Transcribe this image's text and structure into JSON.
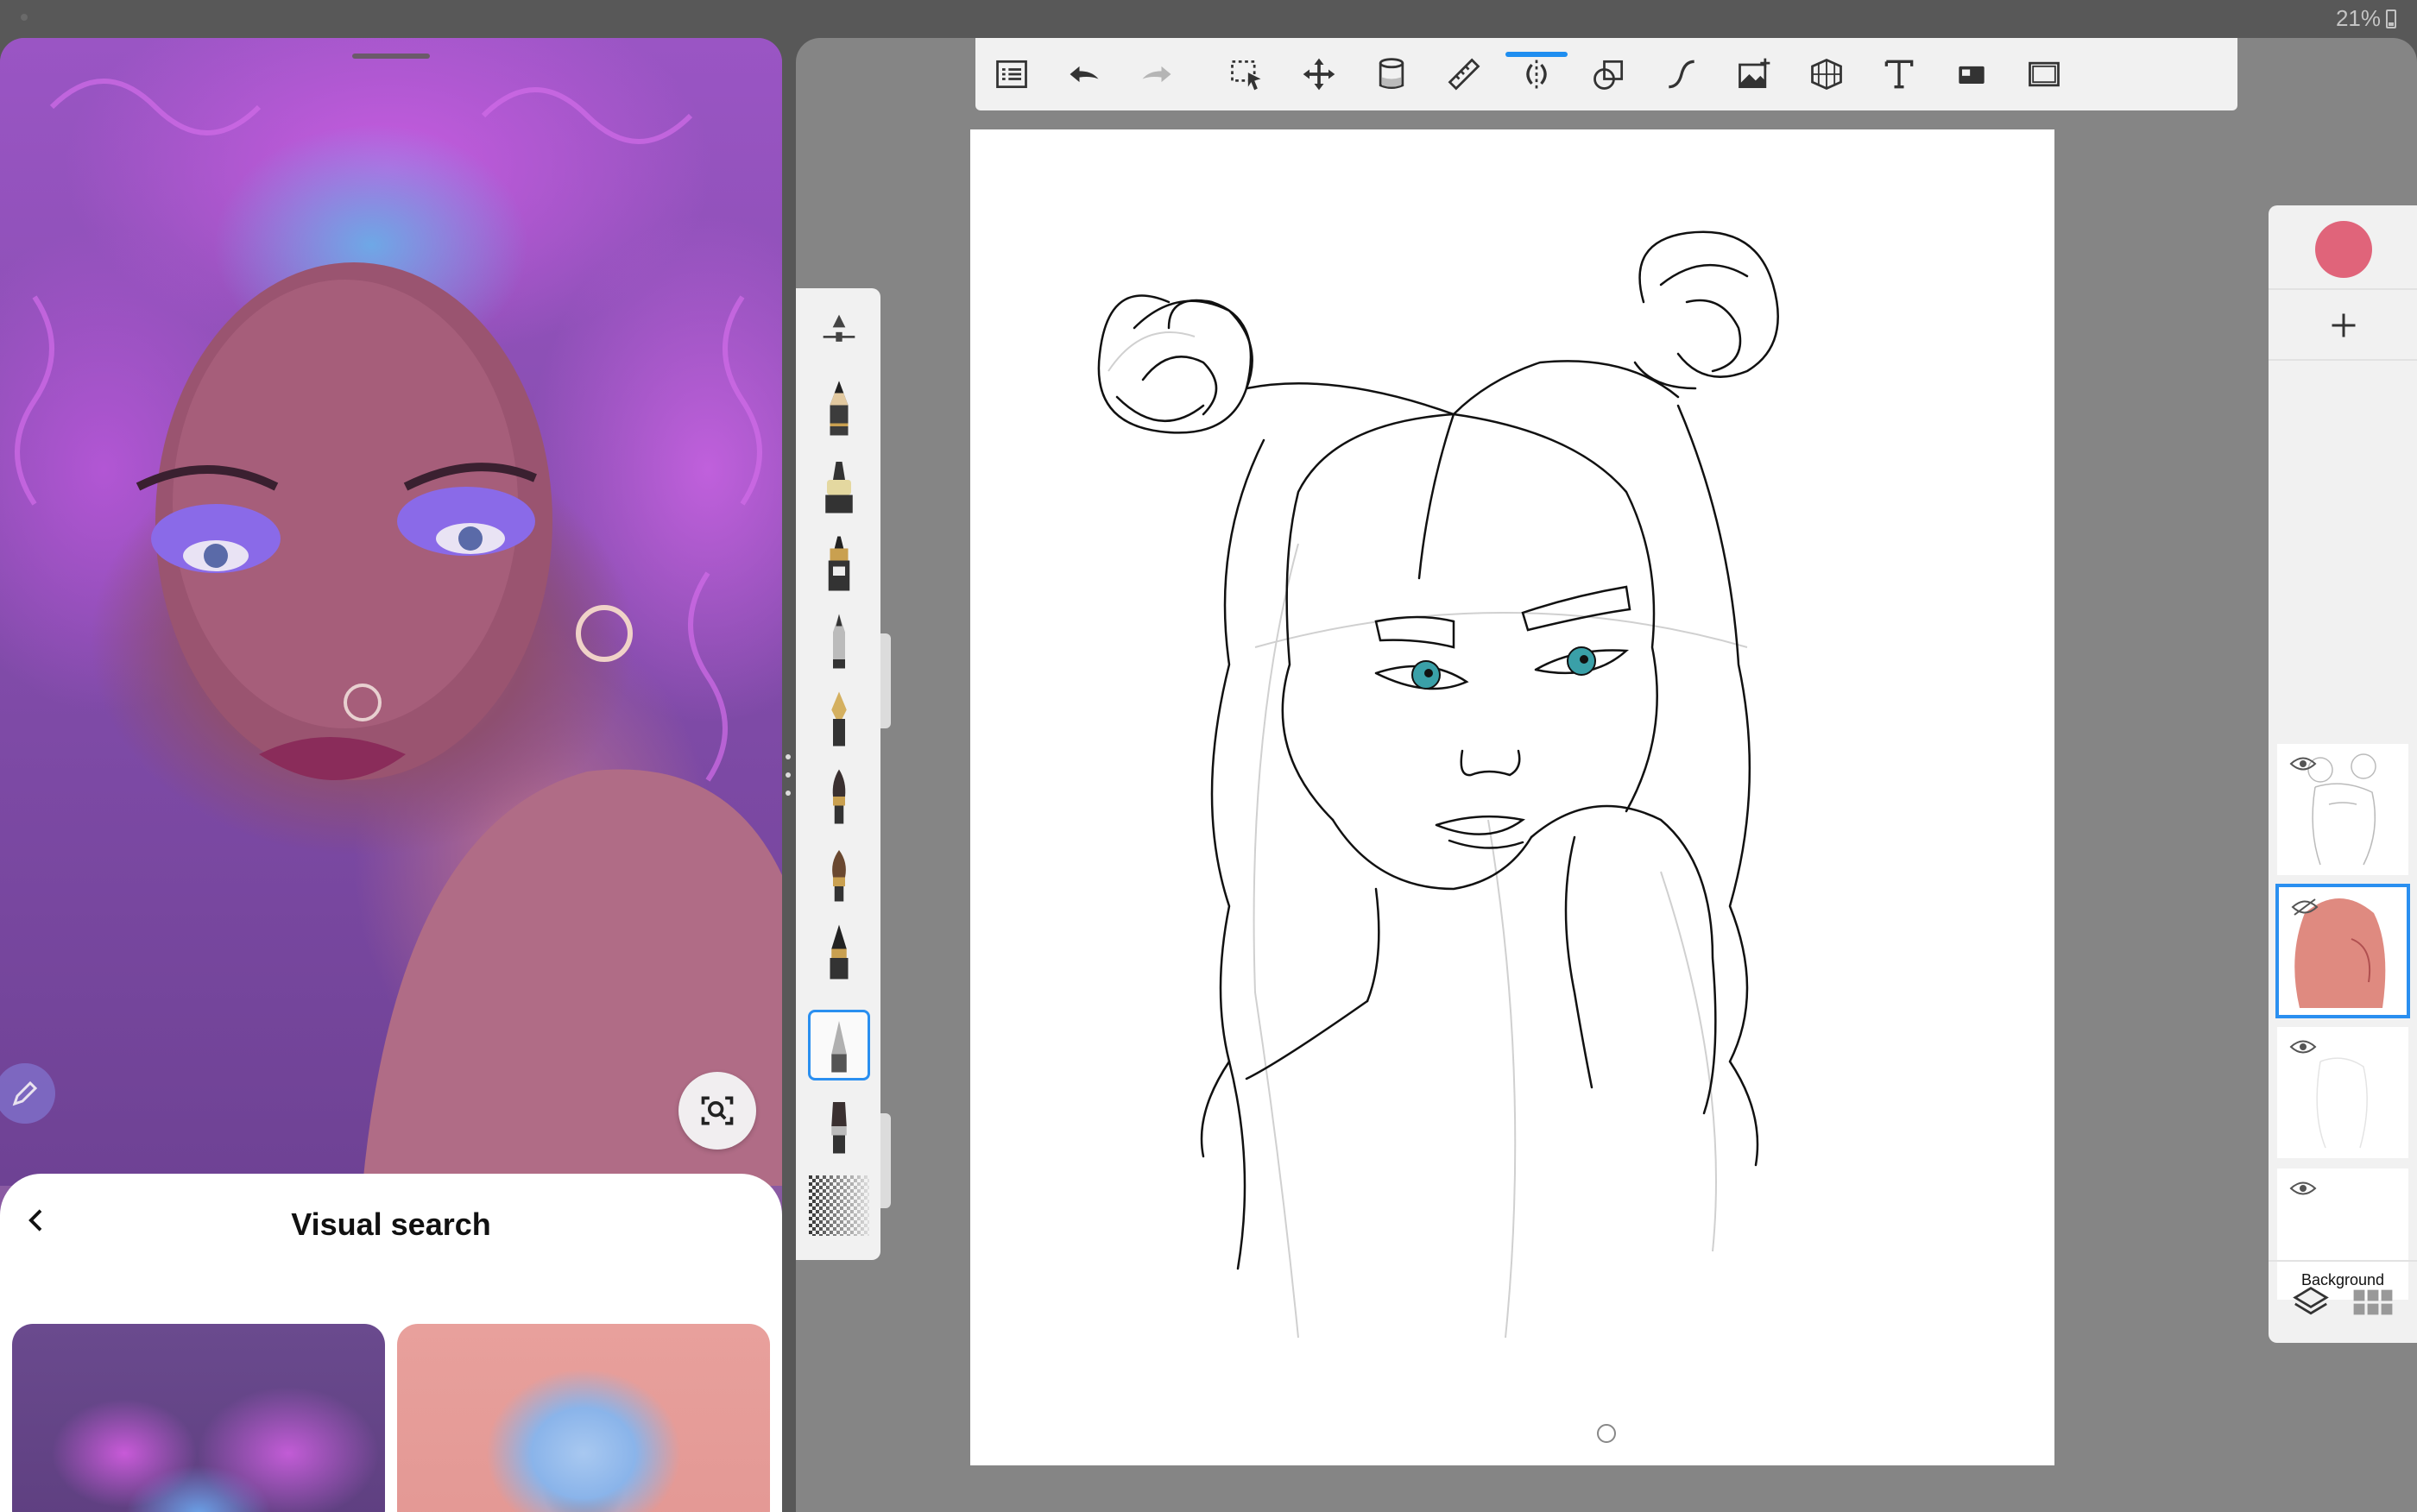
{
  "status_bar": {
    "battery_text": "21%"
  },
  "left_pane": {
    "visual_search": {
      "title": "Visual search",
      "back_icon": "chevron-left-icon",
      "results": [
        {
          "label": "purple-hair-portrait"
        },
        {
          "label": "blue-hair-portrait"
        }
      ]
    },
    "fabs": {
      "edit_icon": "pencil-icon",
      "lens_icon": "visual-search-icon"
    }
  },
  "toolbar": {
    "tools": [
      {
        "name": "gallery-list",
        "icon": "list-icon"
      },
      {
        "name": "undo",
        "icon": "undo-icon"
      },
      {
        "name": "redo",
        "icon": "redo-icon"
      },
      {
        "name": "selection",
        "icon": "selection-icon"
      },
      {
        "name": "transform",
        "icon": "move-icon"
      },
      {
        "name": "fill",
        "icon": "bucket-icon"
      },
      {
        "name": "ruler",
        "icon": "ruler-icon"
      },
      {
        "name": "symmetry",
        "icon": "symmetry-icon",
        "active": true
      },
      {
        "name": "shapes",
        "icon": "shapes-icon"
      },
      {
        "name": "stroke",
        "icon": "curve-icon"
      },
      {
        "name": "import-image",
        "icon": "image-add-icon"
      },
      {
        "name": "perspective",
        "icon": "perspective-grid-icon"
      },
      {
        "name": "text",
        "icon": "text-icon"
      },
      {
        "name": "reference",
        "icon": "reference-icon"
      },
      {
        "name": "fullscreen",
        "icon": "fullscreen-icon"
      }
    ],
    "active_color": "#1f8ef0"
  },
  "brush_palette": {
    "brushes": [
      {
        "name": "size-opacity",
        "icon": "slider-icon"
      },
      {
        "name": "pencil",
        "icon": "pencil-brush-icon"
      },
      {
        "name": "marker",
        "icon": "marker-brush-icon"
      },
      {
        "name": "ink-pen",
        "icon": "ink-brush-icon"
      },
      {
        "name": "ballpoint",
        "icon": "ballpoint-brush-icon"
      },
      {
        "name": "fountain-pen",
        "icon": "nib-brush-icon"
      },
      {
        "name": "paintbrush",
        "icon": "paintbrush-icon"
      },
      {
        "name": "round-brush",
        "icon": "round-brush-icon"
      },
      {
        "name": "felt-tip",
        "icon": "felttip-brush-icon"
      },
      {
        "name": "airbrush",
        "icon": "airbrush-icon",
        "selected": true
      },
      {
        "name": "flat-brush",
        "icon": "flat-brush-icon"
      },
      {
        "name": "texture",
        "icon": "texture-brush-icon"
      }
    ]
  },
  "layers_panel": {
    "current_color": "#e0647a",
    "add_icon": "plus-icon",
    "layers": [
      {
        "name": "",
        "selected": false,
        "thumb": "sketch"
      },
      {
        "name": "",
        "selected": true,
        "thumb": "pink-fill"
      },
      {
        "name": "",
        "selected": false,
        "thumb": "faint"
      },
      {
        "name": "Background",
        "selected": false,
        "thumb": "blank"
      }
    ],
    "bottom_icons": [
      "layers-icon",
      "grid-icon"
    ]
  }
}
